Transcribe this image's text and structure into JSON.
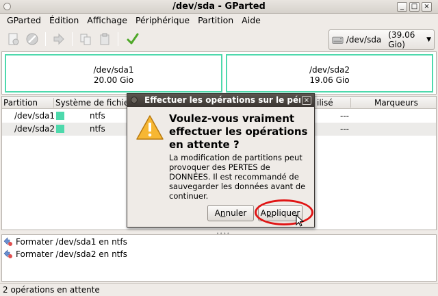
{
  "window": {
    "title": "/dev/sda - GParted",
    "min_glyph": "_",
    "max_glyph": "□",
    "close_glyph": "×"
  },
  "menu": [
    "GParted",
    "Édition",
    "Affichage",
    "Périphérique",
    "Partition",
    "Aide"
  ],
  "toolbar": {
    "icons": [
      "new-partition-icon",
      "delete-icon",
      "resize-icon",
      "copy-icon",
      "paste-icon",
      "apply-check-icon"
    ],
    "device": {
      "name": "/dev/sda",
      "size": "(39.06 Gio)"
    }
  },
  "colors": {
    "ntfs": "#4ed9ac",
    "highlight": "#e01515"
  },
  "graph": [
    {
      "name": "/dev/sda1",
      "size": "20.00 Gio"
    },
    {
      "name": "/dev/sda2",
      "size": "19.06 Gio"
    }
  ],
  "table": {
    "headers": {
      "partition": "Partition",
      "filesystem": "Système de fichiers",
      "used": "ilisé",
      "flags": "Marqueurs"
    },
    "rows": [
      {
        "partition": "/dev/sda1",
        "filesystem": "ntfs",
        "used": "---"
      },
      {
        "partition": "/dev/sda2",
        "filesystem": "ntfs",
        "used": "---"
      }
    ]
  },
  "operations": [
    "Formater /dev/sda1 en ntfs",
    "Formater /dev/sda2 en ntfs"
  ],
  "status": "2 opérations en attente",
  "dialog": {
    "title": "Effectuer les opérations sur le périp",
    "heading": "Voulez-vous vraiment effectuer les opérations en attente ?",
    "body": "La modification de partitions peut provoquer des PERTES de DONNÉES. Il est recommandé de sauvegarder les données avant de continuer.",
    "cancel_pre": "A",
    "cancel_u": "n",
    "cancel_post": "nuler",
    "apply_pre": "A",
    "apply_u": "p",
    "apply_post": "pliquer"
  }
}
